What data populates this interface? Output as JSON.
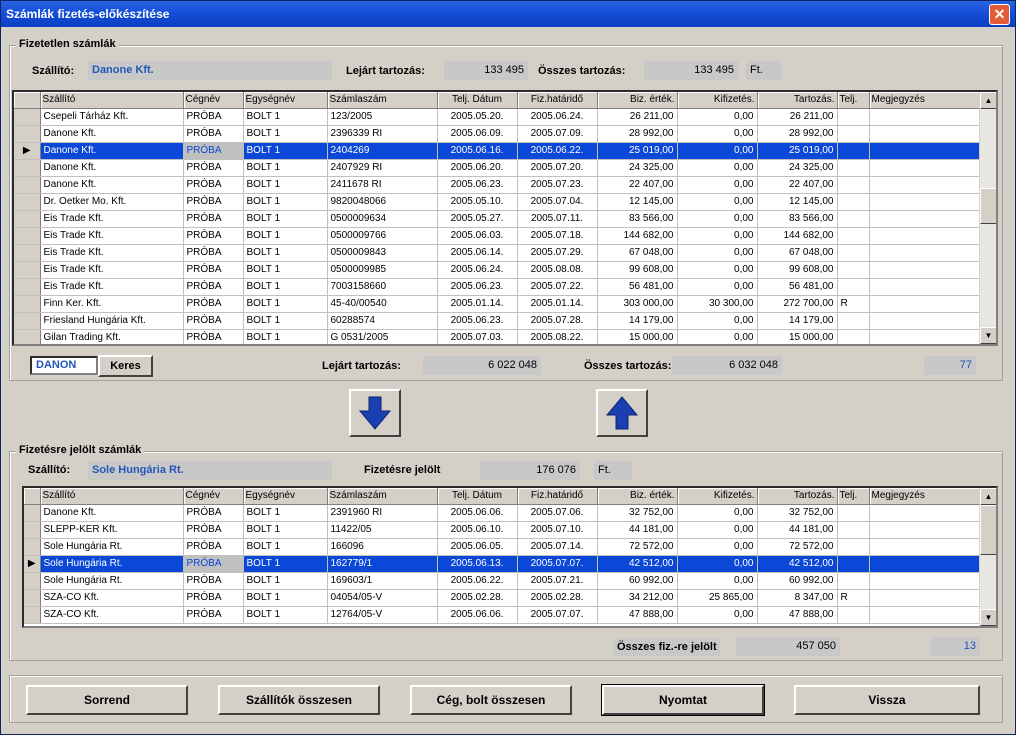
{
  "window": {
    "title": "Számlák fizetés-előkészítése",
    "close_glyph": "✕"
  },
  "unpaid": {
    "legend": "Fizetetlen számlák",
    "supplier_label": "Szállító:",
    "supplier_value": "Danone Kft.",
    "overdue_label": "Lejárt tartozás:",
    "overdue_value": "133 495",
    "total_label": "Összes tartozás:",
    "total_value": "133 495",
    "currency": "Ft.",
    "columns": [
      "Szállító",
      "Cégnév",
      "Egységnév",
      "Számlaszám",
      "Telj. Dátum",
      "Fiz.határidő",
      "Biz. érték.",
      "Kifizetés.",
      "Tartozás.",
      "Telj.",
      "Megjegyzés"
    ],
    "rows": [
      [
        "Csepeli Tárház Kft.",
        "PRÓBA",
        "BOLT 1",
        "123/2005",
        "2005.05.20.",
        "2005.06.24.",
        "26 211,00",
        "0,00",
        "26 211,00",
        "",
        ""
      ],
      [
        "Danone Kft.",
        "PRÓBA",
        "BOLT 1",
        "2396339 RI",
        "2005.06.09.",
        "2005.07.09.",
        "28 992,00",
        "0,00",
        "28 992,00",
        "",
        ""
      ],
      [
        "Danone Kft.",
        "PRÓBA",
        "BOLT 1",
        "2404269",
        "2005.06.16.",
        "2005.06.22.",
        "25 019,00",
        "0,00",
        "25 019,00",
        "",
        ""
      ],
      [
        "Danone Kft.",
        "PRÓBA",
        "BOLT 1",
        "2407929 RI",
        "2005.06.20.",
        "2005.07.20.",
        "24 325,00",
        "0,00",
        "24 325,00",
        "",
        ""
      ],
      [
        "Danone Kft.",
        "PRÓBA",
        "BOLT 1",
        "2411678 RI",
        "2005.06.23.",
        "2005.07.23.",
        "22 407,00",
        "0,00",
        "22 407,00",
        "",
        ""
      ],
      [
        "Dr. Oetker Mo. Kft.",
        "PRÓBA",
        "BOLT 1",
        "9820048066",
        "2005.05.10.",
        "2005.07.04.",
        "12 145,00",
        "0,00",
        "12 145,00",
        "",
        ""
      ],
      [
        "Eis Trade Kft.",
        "PRÓBA",
        "BOLT 1",
        "0500009634",
        "2005.05.27.",
        "2005.07.11.",
        "83 566,00",
        "0,00",
        "83 566,00",
        "",
        ""
      ],
      [
        "Eis Trade Kft.",
        "PRÓBA",
        "BOLT 1",
        "0500009766",
        "2005.06.03.",
        "2005.07.18.",
        "144 682,00",
        "0,00",
        "144 682,00",
        "",
        ""
      ],
      [
        "Eis Trade Kft.",
        "PRÓBA",
        "BOLT 1",
        "0500009843",
        "2005.06.14.",
        "2005.07.29.",
        "67 048,00",
        "0,00",
        "67 048,00",
        "",
        ""
      ],
      [
        "Eis Trade Kft.",
        "PRÓBA",
        "BOLT 1",
        "0500009985",
        "2005.06.24.",
        "2005.08.08.",
        "99 608,00",
        "0,00",
        "99 608,00",
        "",
        ""
      ],
      [
        "Eis Trade Kft.",
        "PRÓBA",
        "BOLT 1",
        "7003158660",
        "2005.06.23.",
        "2005.07.22.",
        "56 481,00",
        "0,00",
        "56 481,00",
        "",
        ""
      ],
      [
        "Finn Ker. Kft.",
        "PRÓBA",
        "BOLT 1",
        "45-40/00540",
        "2005.01.14.",
        "2005.01.14.",
        "303 000,00",
        "30 300,00",
        "272 700,00",
        "R",
        ""
      ],
      [
        "Friesland Hungária Kft.",
        "PRÓBA",
        "BOLT 1",
        "60288574",
        "2005.06.23.",
        "2005.07.28.",
        "14 179,00",
        "0,00",
        "14 179,00",
        "",
        ""
      ],
      [
        "Gilan Trading Kft.",
        "PRÓBA",
        "BOLT 1",
        "G 0531/2005",
        "2005.07.03.",
        "2005.08.22.",
        "15 000,00",
        "0,00",
        "15 000,00",
        "",
        ""
      ]
    ],
    "selected_row": 2,
    "search_value": "DANON",
    "search_button": "Keres",
    "overdue_label2": "Lejárt tartozás:",
    "overdue_value2": "6 022 048",
    "total_label2": "Összes tartozás:",
    "total_value2": "6 032 048",
    "count": "77"
  },
  "marked": {
    "legend": "Fizetésre jelölt számlák",
    "supplier_label": "Szállító:",
    "supplier_value": "Sole Hungária Rt.",
    "marked_label": "Fizetésre jelölt",
    "marked_value": "176 076",
    "currency": "Ft.",
    "columns": [
      "Szállító",
      "Cégnév",
      "Egységnév",
      "Számlaszám",
      "Telj. Dátum",
      "Fiz.határidő",
      "Biz. érték.",
      "Kifizetés.",
      "Tartozás.",
      "Telj.",
      "Megjegyzés"
    ],
    "rows": [
      [
        "Danone Kft.",
        "PRÓBA",
        "BOLT 1",
        "2391960 RI",
        "2005.06.06.",
        "2005.07.06.",
        "32 752,00",
        "0,00",
        "32 752,00",
        "",
        ""
      ],
      [
        "SLEPP-KER Kft.",
        "PRÓBA",
        "BOLT 1",
        "11422/05",
        "2005.06.10.",
        "2005.07.10.",
        "44 181,00",
        "0,00",
        "44 181,00",
        "",
        ""
      ],
      [
        "Sole Hungária Rt.",
        "PRÓBA",
        "BOLT 1",
        "166096",
        "2005.06.05.",
        "2005.07.14.",
        "72 572,00",
        "0,00",
        "72 572,00",
        "",
        ""
      ],
      [
        "Sole Hungária Rt.",
        "PRÓBA",
        "BOLT 1",
        "162779/1",
        "2005.06.13.",
        "2005.07.07.",
        "42 512,00",
        "0,00",
        "42 512,00",
        "",
        ""
      ],
      [
        "Sole Hungária Rt.",
        "PRÓBA",
        "BOLT 1",
        "169603/1",
        "2005.06.22.",
        "2005.07.21.",
        "60 992,00",
        "0,00",
        "60 992,00",
        "",
        ""
      ],
      [
        "SZA-CO Kft.",
        "PRÓBA",
        "BOLT 1",
        "04054/05-V",
        "2005.02.28.",
        "2005.02.28.",
        "34 212,00",
        "25 865,00",
        "8 347,00",
        "R",
        ""
      ],
      [
        "SZA-CO Kft.",
        "PRÓBA",
        "BOLT 1",
        "12764/05-V",
        "2005.06.06.",
        "2005.07.07.",
        "47 888,00",
        "0,00",
        "47 888,00",
        "",
        ""
      ]
    ],
    "selected_row": 3,
    "total_marked_label": "Összes fiz.-re jelölt",
    "total_marked_value": "457 050",
    "count": "13"
  },
  "buttons": {
    "sort": "Sorrend",
    "suppliers_total": "Szállítók összesen",
    "company_shop_total": "Cég, bolt összesen",
    "print": "Nyomtat",
    "back": "Vissza"
  },
  "colors": {
    "selection": "#0b48d8",
    "title_bar": "#1651d9",
    "value_text": "#2456b8"
  }
}
